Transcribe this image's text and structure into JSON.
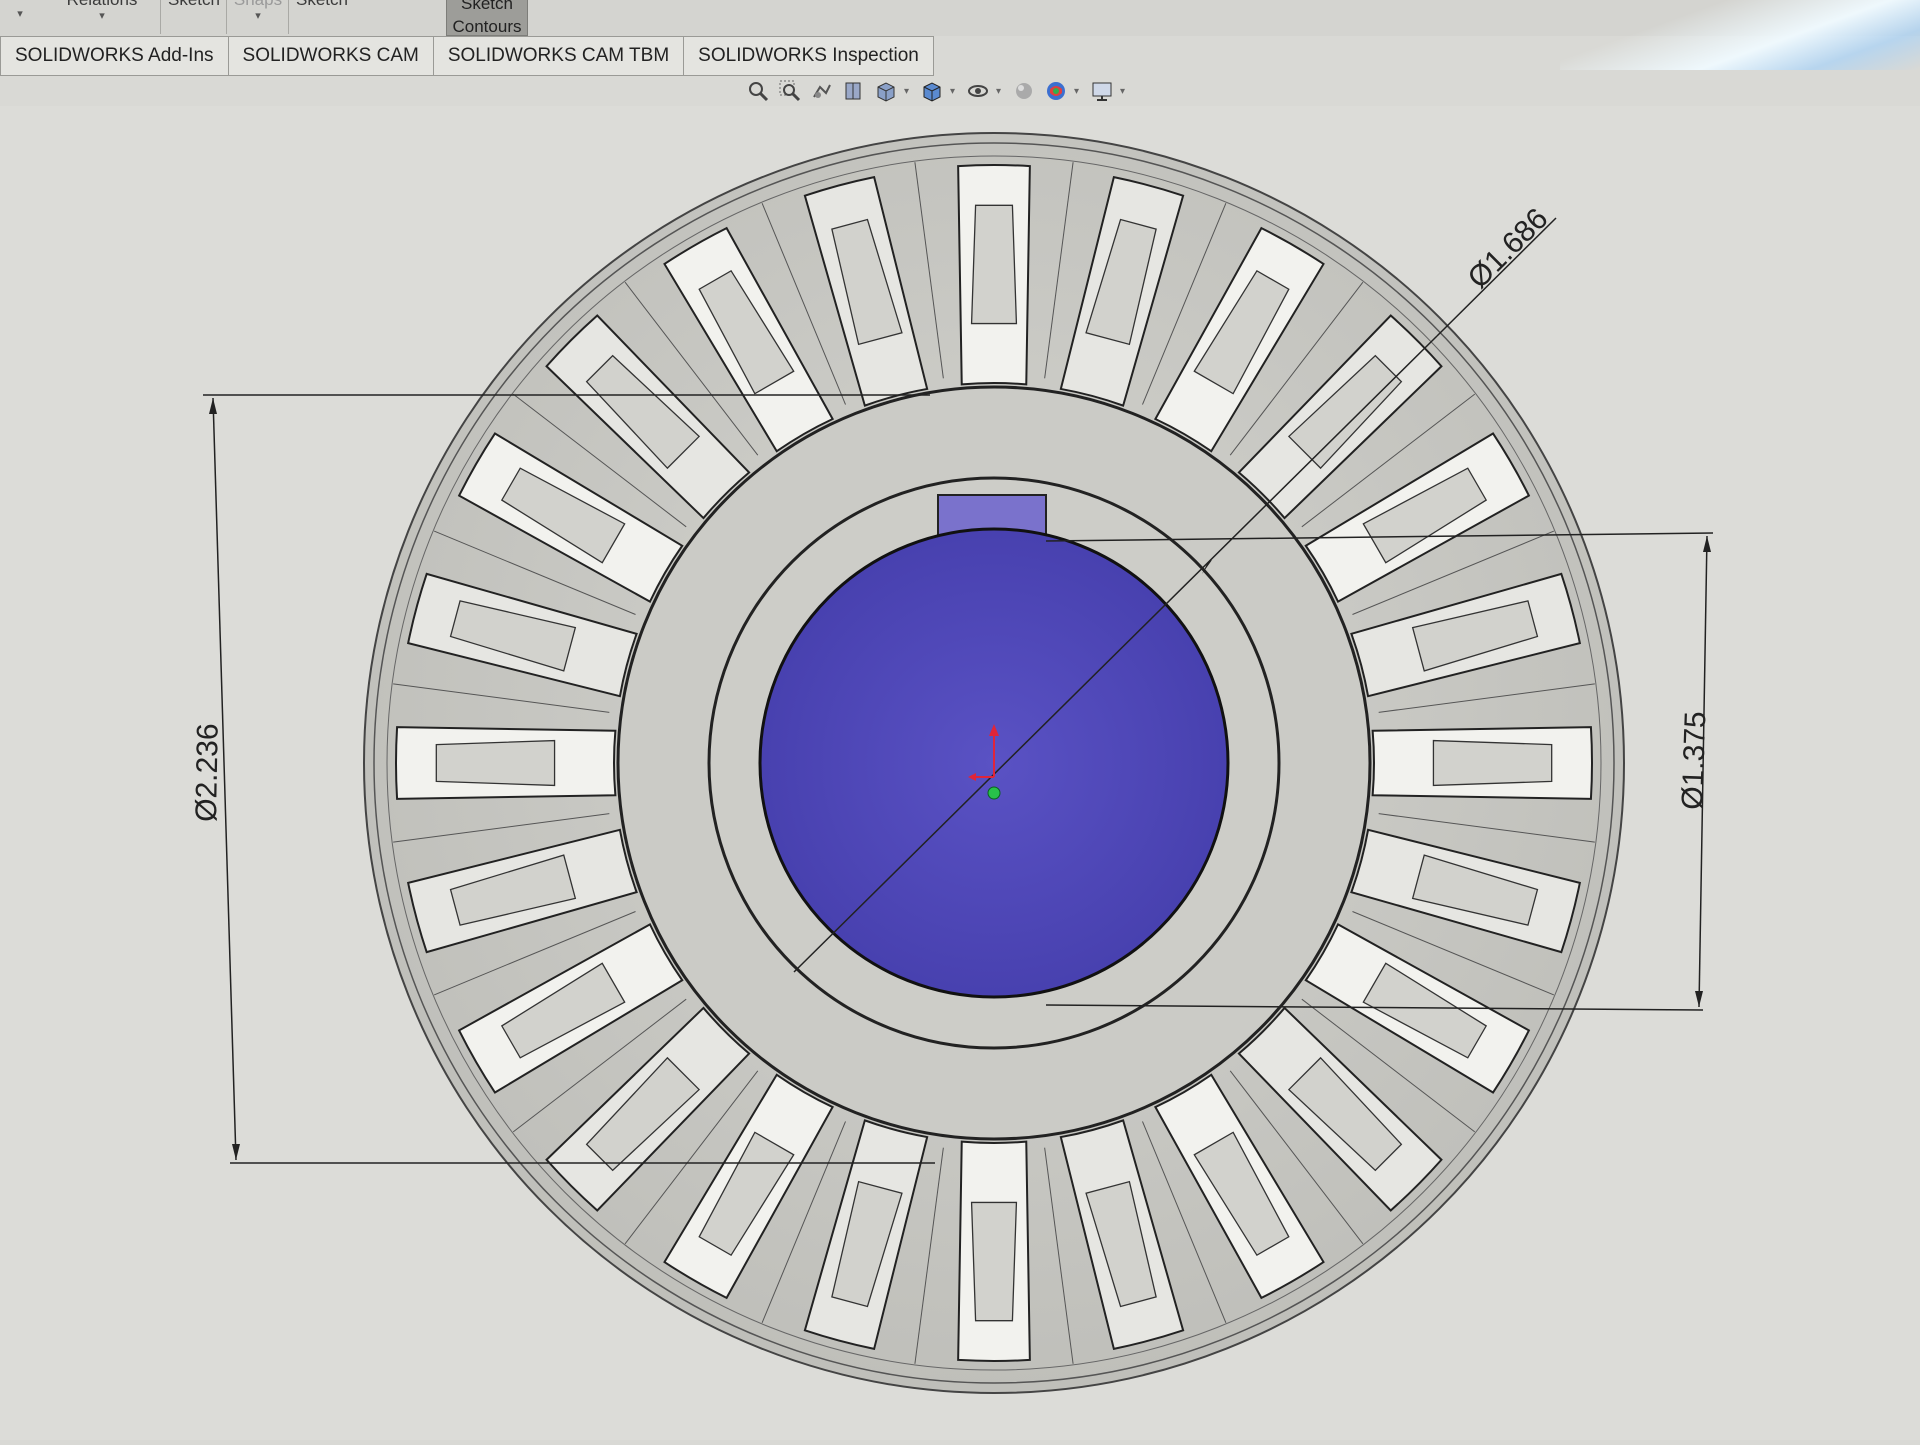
{
  "command_strip": {
    "relations_label": "Relations",
    "sketch_label_1": "Sketch",
    "snaps_label": "Snaps",
    "sketch_label_2": "Sketch",
    "sketch_contours_line1": "Sketch",
    "sketch_contours_line2": "Contours"
  },
  "tabs": [
    {
      "label": "SOLIDWORKS Add-Ins"
    },
    {
      "label": "SOLIDWORKS CAM"
    },
    {
      "label": "SOLIDWORKS CAM TBM"
    },
    {
      "label": "SOLIDWORKS Inspection"
    }
  ],
  "view_toolbar": {
    "icons": [
      "zoom-to-fit-icon",
      "zoom-to-area-icon",
      "previous-view-icon",
      "section-view-icon",
      "view-orientation-icon",
      "display-style-icon",
      "hide-show-items-icon",
      "edit-appearance-icon",
      "apply-scene-icon",
      "view-settings-icon"
    ]
  },
  "dimensions": {
    "outer_diameter": "Ø2.236",
    "bore_diameter": "Ø1.375",
    "hub_diameter": "Ø1.686"
  },
  "colors": {
    "bore_fill": "#5048b8",
    "key_fill": "#7a72cc",
    "part_fill": "#c6c6c1",
    "origin_red": "#e0253a",
    "origin_green": "#28c04a"
  }
}
